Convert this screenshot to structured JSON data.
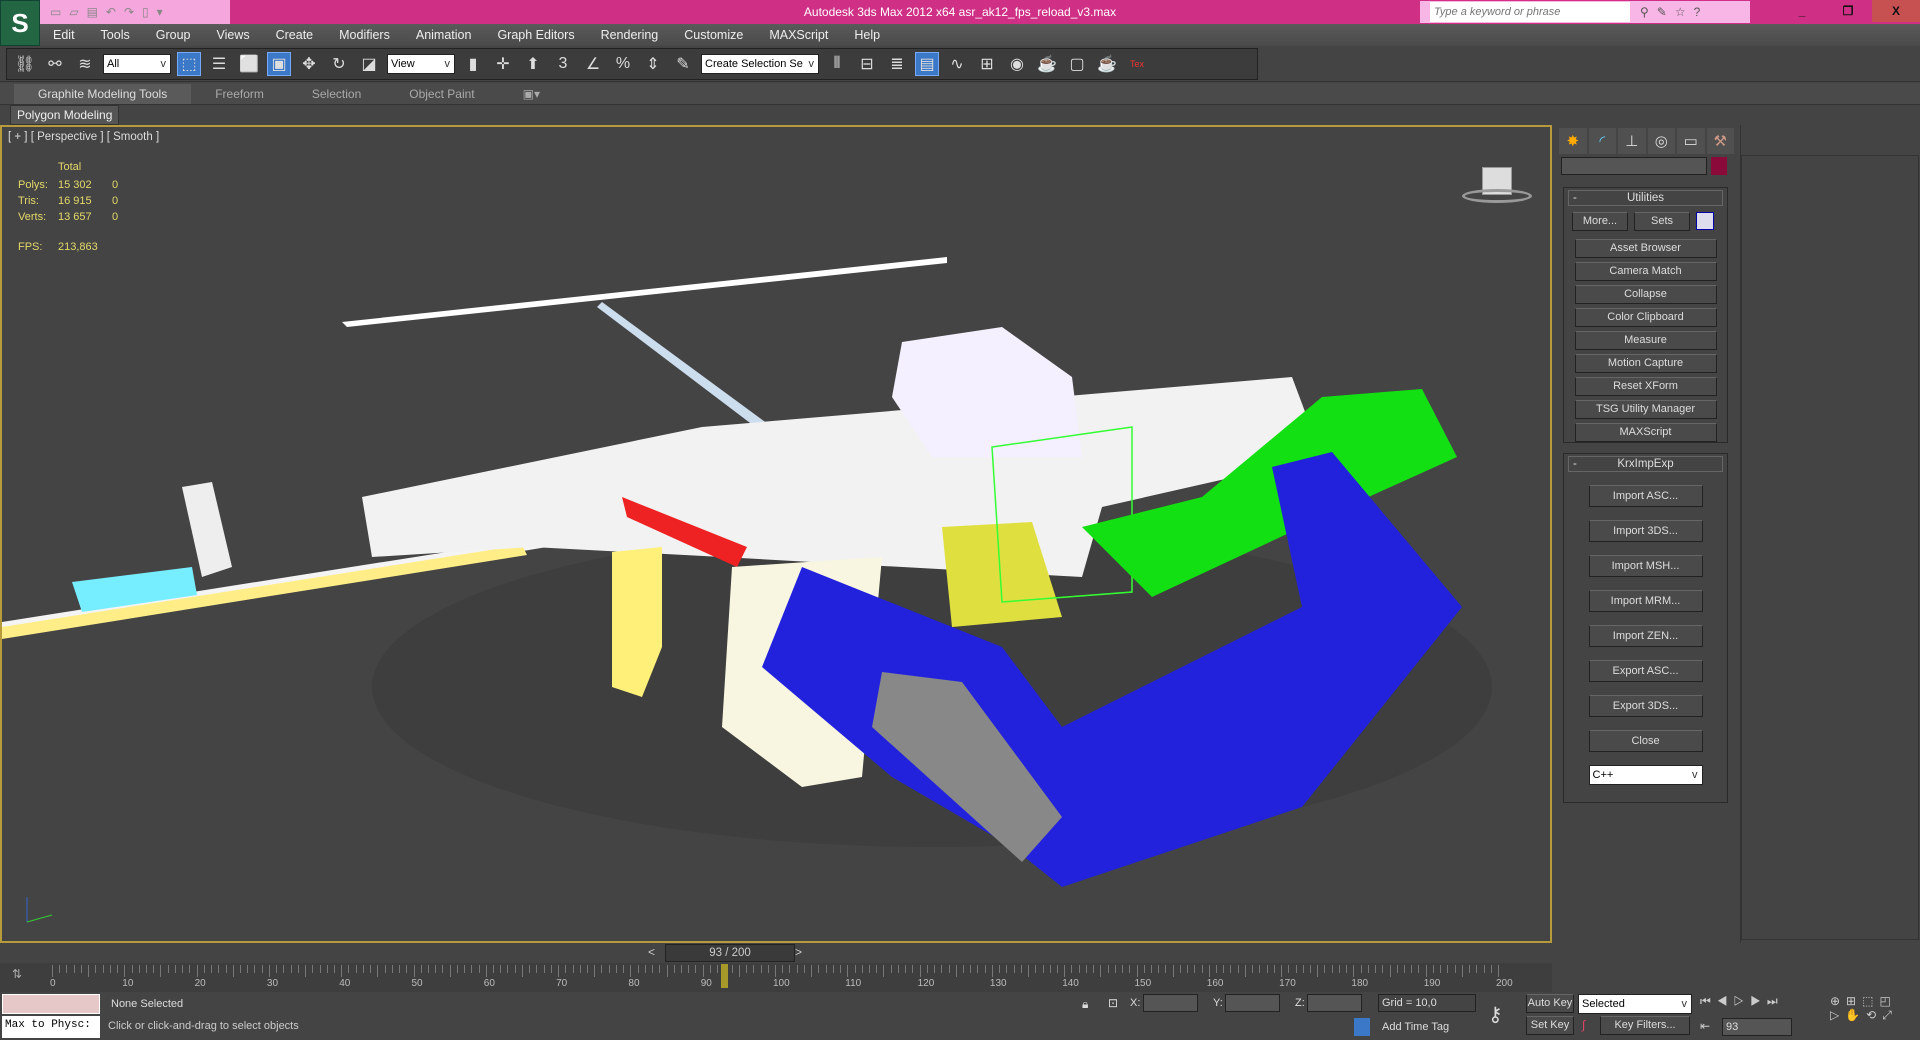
{
  "title": "Autodesk 3ds Max  2012 x64     asr_ak12_fps_reload_v3.max",
  "search_placeholder": "Type a keyword or phrase",
  "window_buttons": {
    "minimize": "_",
    "restore": "❐",
    "close": "X"
  },
  "menu": [
    "Edit",
    "Tools",
    "Group",
    "Views",
    "Create",
    "Modifiers",
    "Animation",
    "Graph Editors",
    "Rendering",
    "Customize",
    "MAXScript",
    "Help"
  ],
  "toolbar": {
    "selection_filter": "All",
    "ref_coord": "View",
    "named_selection": "Create Selection Se"
  },
  "ribbon_tabs": [
    "Graphite Modeling Tools",
    "Freeform",
    "Selection",
    "Object Paint"
  ],
  "ribbon_panel": "Polygon Modeling",
  "viewport": {
    "label": "[ + ] [ Perspective ] [ Smooth ]",
    "stats": {
      "header": "Total",
      "rows": [
        {
          "k": "Polys:",
          "v": "15 302",
          "s": "0"
        },
        {
          "k": "Tris:",
          "v": "16 915",
          "s": "0"
        },
        {
          "k": "Verts:",
          "v": "13 657",
          "s": "0"
        }
      ],
      "fps_label": "FPS:",
      "fps": "213,863"
    }
  },
  "command_panel": {
    "utilities_title": "Utilities",
    "more": "More...",
    "sets": "Sets",
    "utilities": [
      "Asset Browser",
      "Camera Match",
      "Collapse",
      "Color Clipboard",
      "Measure",
      "Motion Capture",
      "Reset XForm",
      "TSG Utility Manager",
      "MAXScript"
    ],
    "krx_title": "KrxImpExp",
    "krx_buttons": [
      "Import ASC...",
      "Import 3DS...",
      "Import MSH...",
      "Import MRM...",
      "Import ZEN...",
      "Export ASC...",
      "Export 3DS...",
      "Close"
    ],
    "language": "C++",
    "color_swatch": "#8a0a3a"
  },
  "timeline": {
    "frame": "93 / 200",
    "current": 93,
    "max": 200,
    "ticks": [
      "0",
      "10",
      "20",
      "30",
      "40",
      "50",
      "60",
      "70",
      "80",
      "90",
      "100",
      "110",
      "120",
      "130",
      "140",
      "150",
      "160",
      "170",
      "180",
      "190",
      "200"
    ]
  },
  "status": {
    "maxscript": "Max to Physc:",
    "selection": "None Selected",
    "prompt": "Click or click-and-drag to select objects",
    "x_label": "X:",
    "y_label": "Y:",
    "z_label": "Z:",
    "grid": "Grid = 10,0",
    "add_time_tag": "Add Time Tag",
    "auto_key": "Auto Key",
    "set_key": "Set Key",
    "key_mode": "Selected",
    "key_filters": "Key Filters...",
    "frame_field": "93"
  }
}
